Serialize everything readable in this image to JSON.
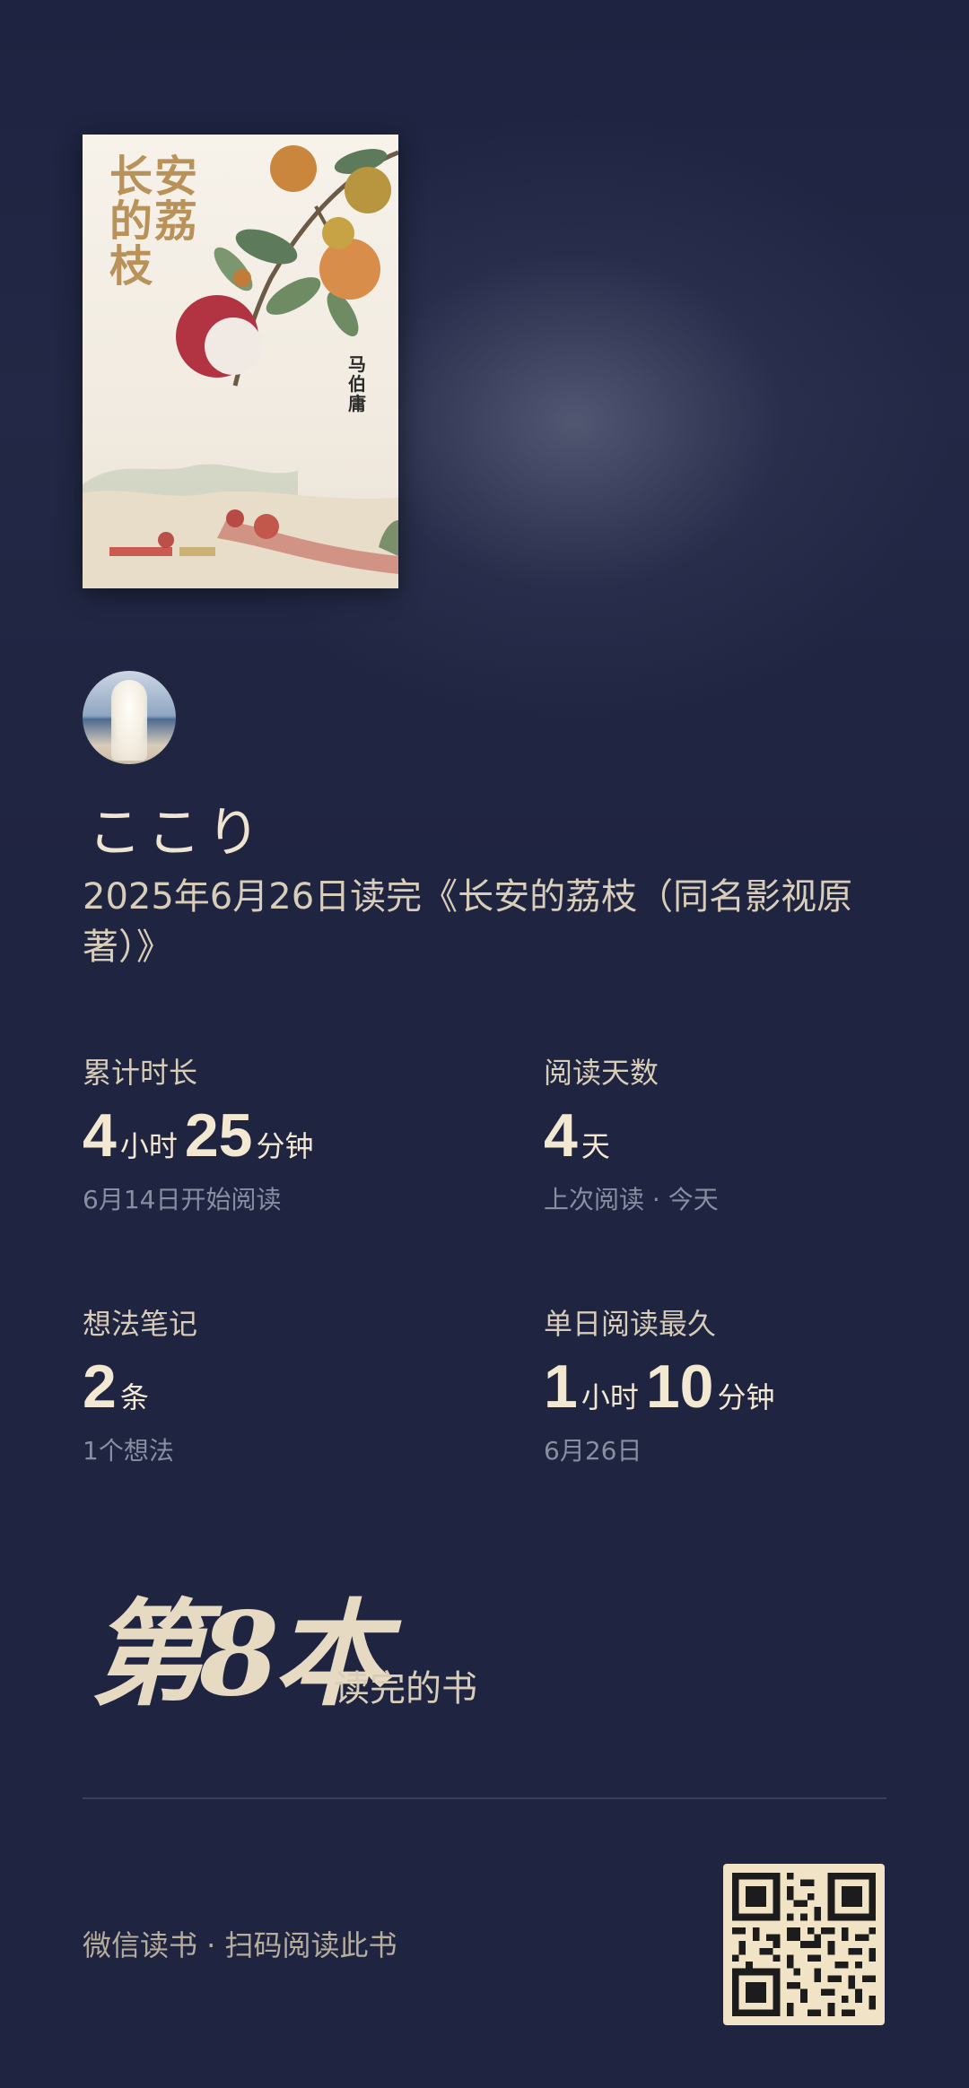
{
  "book": {
    "cover_title": "长安的荔枝",
    "cover_author": "马伯庸"
  },
  "user": {
    "name": "ここり"
  },
  "finish": {
    "text": "2025年6月26日读完《长安的荔枝（同名影视原著）》"
  },
  "stats": {
    "total_time": {
      "label": "累计时长",
      "hours": "4",
      "hours_unit": "小时",
      "minutes": "25",
      "minutes_unit": "分钟",
      "sub": "6月14日开始阅读"
    },
    "reading_days": {
      "label": "阅读天数",
      "value": "4",
      "unit": "天",
      "sub": "上次阅读 · 今天"
    },
    "notes": {
      "label": "想法笔记",
      "value": "2",
      "unit": "条",
      "sub": "1个想法"
    },
    "longest_day": {
      "label": "单日阅读最久",
      "hours": "1",
      "hours_unit": "小时",
      "minutes": "10",
      "minutes_unit": "分钟",
      "sub": "6月26日"
    }
  },
  "rank": {
    "big_text": "第8本",
    "label": "读完的书"
  },
  "footer": {
    "text": "微信读书 · 扫码阅读此书"
  },
  "colors": {
    "background": "#1f2440",
    "accent_text": "#f3e8d2",
    "muted_text": "#8a8ea3",
    "qr_background": "#f1e3c6"
  }
}
